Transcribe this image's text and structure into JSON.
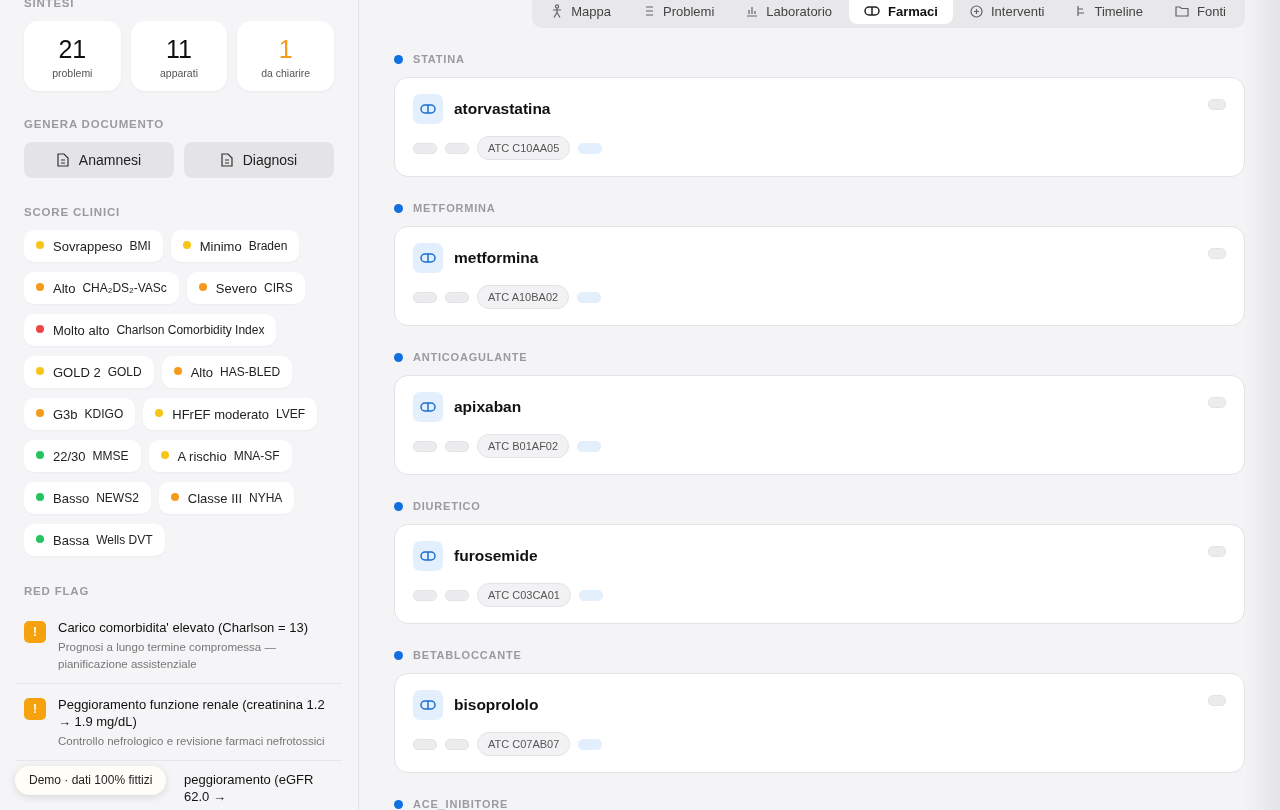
{
  "sidebar": {
    "summary": {
      "title": "SINTESI",
      "stats": [
        {
          "value": "21",
          "label": "problemi",
          "accent": false
        },
        {
          "value": "11",
          "label": "apparati",
          "accent": false
        },
        {
          "value": "1",
          "label": "da chiarire",
          "accent": true
        }
      ]
    },
    "documents": {
      "title": "GENERA DOCUMENTO",
      "buttons": [
        "Anamnesi",
        "Diagnosi"
      ]
    },
    "scores_title": "SCORE CLINICI",
    "scores": [
      {
        "value": "Sovrappeso",
        "name": "BMI",
        "color": "#f5c518"
      },
      {
        "value": "Minimo",
        "name": "Braden",
        "color": "#f5c518"
      },
      {
        "value": "Alto",
        "name": "CHA₂DS₂-VASc",
        "color": "#f59a1b"
      },
      {
        "value": "Severo",
        "name": "CIRS",
        "color": "#f59a1b"
      },
      {
        "value": "Molto alto",
        "name": "Charlson Comorbidity Index",
        "color": "#ef4444"
      },
      {
        "value": "GOLD 2",
        "name": "GOLD",
        "color": "#f5c518"
      },
      {
        "value": "Alto",
        "name": "HAS-BLED",
        "color": "#f59a1b"
      },
      {
        "value": "G3b",
        "name": "KDIGO",
        "color": "#f59a1b"
      },
      {
        "value": "HFrEF moderato",
        "name": "LVEF",
        "color": "#f5c518"
      },
      {
        "value": "22/30",
        "name": "MMSE",
        "color": "#22c55e"
      },
      {
        "value": "A rischio",
        "name": "MNA-SF",
        "color": "#f5c518"
      },
      {
        "value": "Basso",
        "name": "NEWS2",
        "color": "#22c55e"
      },
      {
        "value": "Classe III",
        "name": "NYHA",
        "color": "#f59a1b"
      },
      {
        "value": "Bassa",
        "name": "Wells DVT",
        "color": "#22c55e"
      }
    ],
    "red_flags_title": "RED FLAG",
    "red_flags": [
      {
        "icon": "!",
        "title": "Carico comorbidita' elevato (Charlson = 13)",
        "detail": "Prognosi a lungo termine compromessa — pianificazione assistenziale"
      },
      {
        "icon": "!",
        "title": "Peggioramento funzione renale (creatinina 1.2 → 1.9 mg/dL)",
        "detail": "Controllo nefrologico e revisione farmaci nefrotossici"
      },
      {
        "title": "peggioramento (eGFR 62.0 →"
      }
    ]
  },
  "tabs": [
    {
      "label": "Mappa",
      "selected": false
    },
    {
      "label": "Problemi",
      "selected": false
    },
    {
      "label": "Laboratorio",
      "selected": false
    },
    {
      "label": "Farmaci",
      "selected": true
    },
    {
      "label": "Interventi",
      "selected": false
    },
    {
      "label": "Timeline",
      "selected": false
    },
    {
      "label": "Fonti",
      "selected": false
    }
  ],
  "drug_groups": [
    {
      "category": "STATINA",
      "drugs": [
        {
          "name": "atorvastatina",
          "atc": "ATC C10AA05"
        }
      ]
    },
    {
      "category": "METFORMINA",
      "drugs": [
        {
          "name": "metformina",
          "atc": "ATC A10BA02"
        }
      ]
    },
    {
      "category": "ANTICOAGULANTE",
      "drugs": [
        {
          "name": "apixaban",
          "atc": "ATC B01AF02"
        }
      ]
    },
    {
      "category": "DIURETICO",
      "drugs": [
        {
          "name": "furosemide",
          "atc": "ATC C03CA01"
        }
      ]
    },
    {
      "category": "BETABLOCCANTE",
      "drugs": [
        {
          "name": "bisoprololo",
          "atc": "ATC C07AB07"
        }
      ]
    },
    {
      "category": "ACE_INIBITORE"
    }
  ],
  "toast": "Demo · dati 100% fittizi"
}
